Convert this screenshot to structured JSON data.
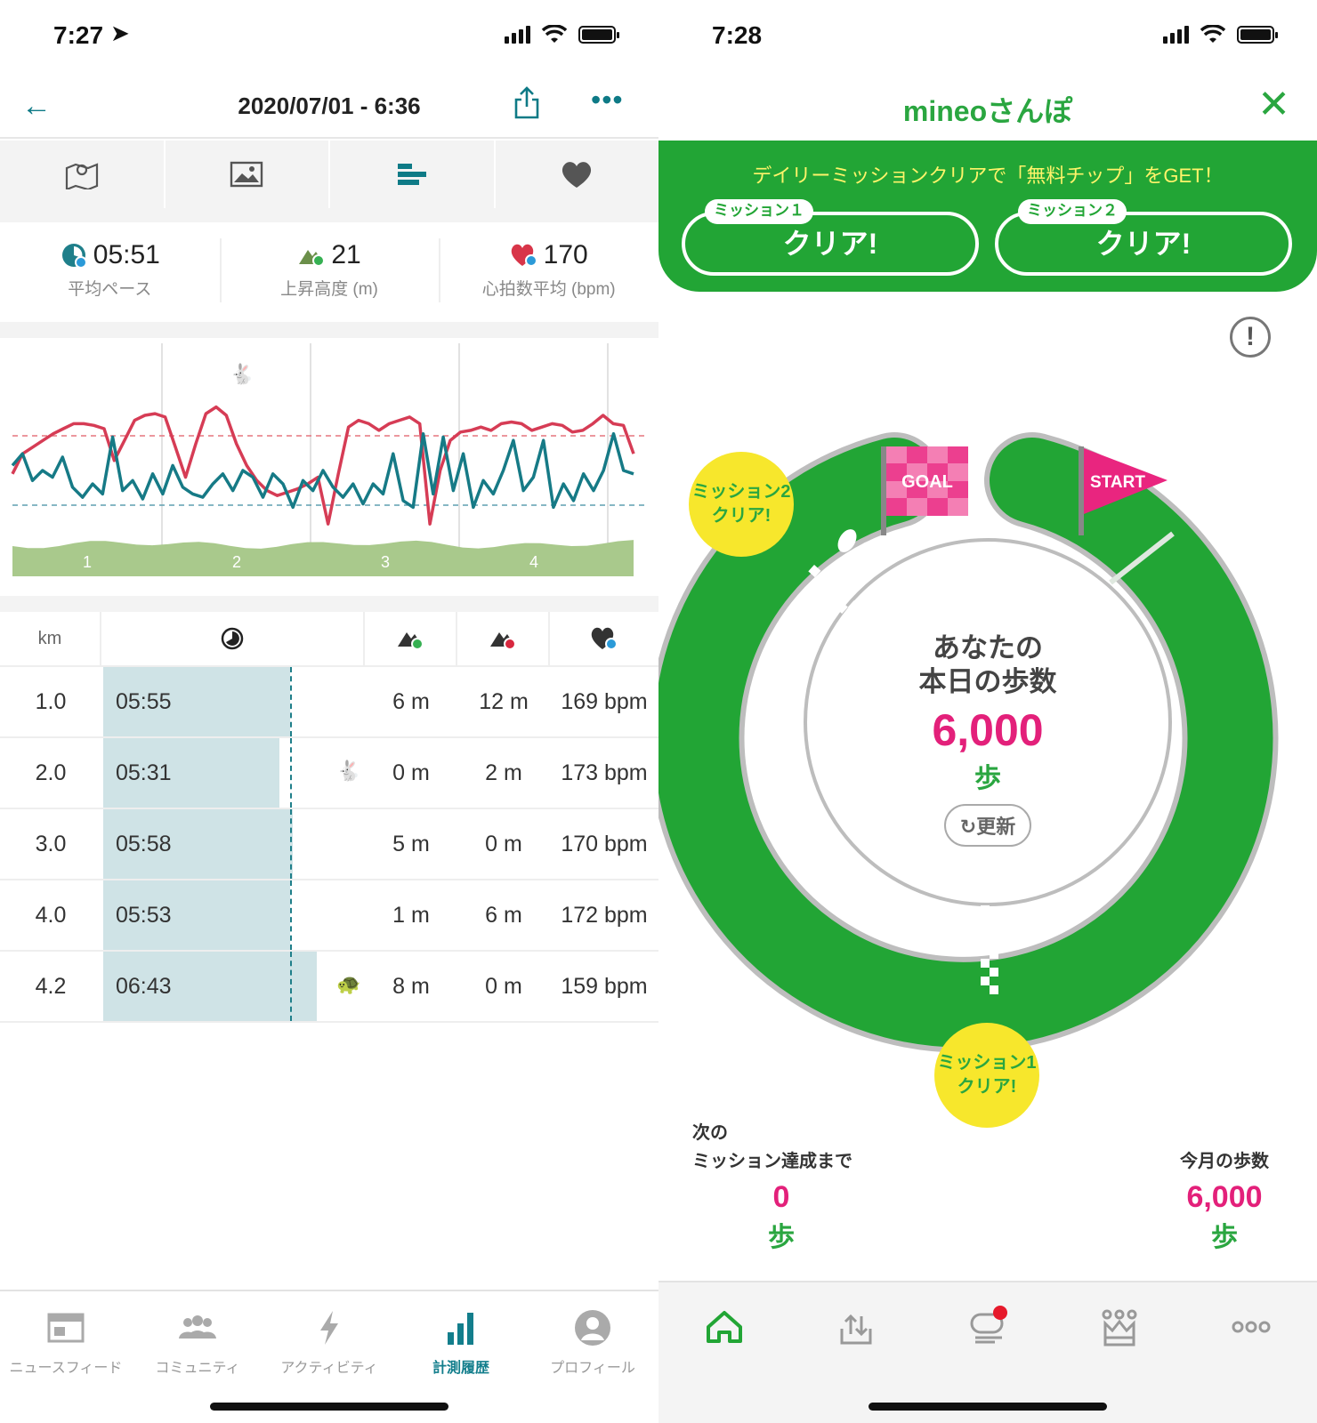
{
  "left": {
    "status_time": "7:27",
    "header": {
      "title": "2020/07/01 - 6:36"
    },
    "tabs": [
      "map-icon",
      "photo-icon",
      "laps-icon",
      "heart-icon"
    ],
    "stats": [
      {
        "value": "05:51",
        "label": "平均ペース",
        "icon": "pace-icon"
      },
      {
        "value": "21",
        "label": "上昇高度 (m)",
        "icon": "elevation-up-icon"
      },
      {
        "value": "170",
        "label": "心拍数平均 (bpm)",
        "icon": "heart-rate-icon"
      }
    ],
    "chart_data": {
      "type": "line",
      "x_ticks": [
        "1",
        "2",
        "3",
        "4"
      ],
      "series": [
        {
          "name": "",
          "color": "#d63c55",
          "values": [
            60,
            48,
            44,
            40,
            36,
            33,
            30,
            30,
            31,
            33,
            52,
            40,
            28,
            25,
            24,
            26,
            44,
            62,
            42,
            24,
            20,
            25,
            42,
            55,
            64,
            70,
            73,
            71,
            69,
            66,
            62,
            90,
            60,
            32,
            28,
            30,
            34,
            30,
            28,
            26,
            30,
            90,
            58,
            40,
            35,
            34,
            32,
            34,
            30,
            29,
            30,
            34,
            32,
            30,
            31,
            35,
            34,
            30,
            25,
            30,
            31,
            48
          ]
        },
        {
          "name": "",
          "color": "#167a86",
          "values": [
            55,
            48,
            64,
            58,
            62,
            50,
            68,
            74,
            66,
            72,
            38,
            70,
            64,
            75,
            60,
            72,
            55,
            68,
            72,
            74,
            66,
            60,
            70,
            58,
            62,
            74,
            60,
            66,
            80,
            64,
            70,
            58,
            68,
            74,
            66,
            78,
            66,
            72,
            48,
            76,
            80,
            36,
            72,
            38,
            70,
            48,
            80,
            64,
            72,
            58,
            40,
            70,
            62,
            40,
            80,
            66,
            76,
            60,
            70,
            58,
            36,
            58,
            60
          ]
        }
      ],
      "ref_lines": {
        "heart_avg_color": "#e5757f",
        "pace_avg_color": "#5f9fb0"
      }
    },
    "table": {
      "headers": [
        "km",
        "pace-icon",
        "elevation-up-icon",
        "elevation-down-icon",
        "heart-rate-icon"
      ],
      "rows": [
        {
          "km": "1.0",
          "pace": "05:55",
          "fill": 0.71,
          "up": "6 m",
          "down": "12 m",
          "hr": "169 bpm",
          "icon": ""
        },
        {
          "km": "2.0",
          "pace": "05:31",
          "fill": 0.67,
          "up": "0 m",
          "down": "2 m",
          "hr": "173 bpm",
          "icon": "rabbit-icon"
        },
        {
          "km": "3.0",
          "pace": "05:58",
          "fill": 0.72,
          "up": "5 m",
          "down": "0 m",
          "hr": "170 bpm",
          "icon": ""
        },
        {
          "km": "4.0",
          "pace": "05:53",
          "fill": 0.71,
          "up": "1 m",
          "down": "6 m",
          "hr": "172 bpm",
          "icon": ""
        },
        {
          "km": "4.2",
          "pace": "06:43",
          "fill": 0.81,
          "up": "8 m",
          "down": "0 m",
          "hr": "159 bpm",
          "icon": "turtle-icon"
        }
      ]
    },
    "nav": [
      {
        "label": "ニュースフィード",
        "icon": "newsfeed-icon"
      },
      {
        "label": "コミュニティ",
        "icon": "community-icon"
      },
      {
        "label": "アクティビティ",
        "icon": "activity-icon"
      },
      {
        "label": "計測履歴",
        "icon": "history-icon",
        "active": true
      },
      {
        "label": "プロフィール",
        "icon": "profile-icon"
      }
    ]
  },
  "right": {
    "status_time": "7:28",
    "header": {
      "title": "mineoさんぽ"
    },
    "banner": {
      "text": "デイリーミッションクリアで「無料チップ」をGET！",
      "missions": [
        {
          "tag": "ミッション１",
          "status": "クリア!"
        },
        {
          "tag": "ミッション２",
          "status": "クリア!"
        }
      ]
    },
    "track": {
      "goal": "GOAL",
      "start": "START",
      "bubble_mission2": "ミッション2\nクリア!",
      "bubble_mission1": "ミッション1\nクリア!",
      "center_title_1": "あなたの",
      "center_title_2": "本日の歩数",
      "steps_today": "6,000",
      "unit": "歩",
      "refresh": "更新"
    },
    "bottom": {
      "next_label_1": "次の",
      "next_label_2": "ミッション達成まで",
      "next_value": "0",
      "next_unit": "歩",
      "month_label": "今月の歩数",
      "month_value": "6,000",
      "month_unit": "歩"
    },
    "colors": {
      "green": "#22a535",
      "pink": "#e3207a",
      "yellow": "#f7e72c"
    }
  }
}
